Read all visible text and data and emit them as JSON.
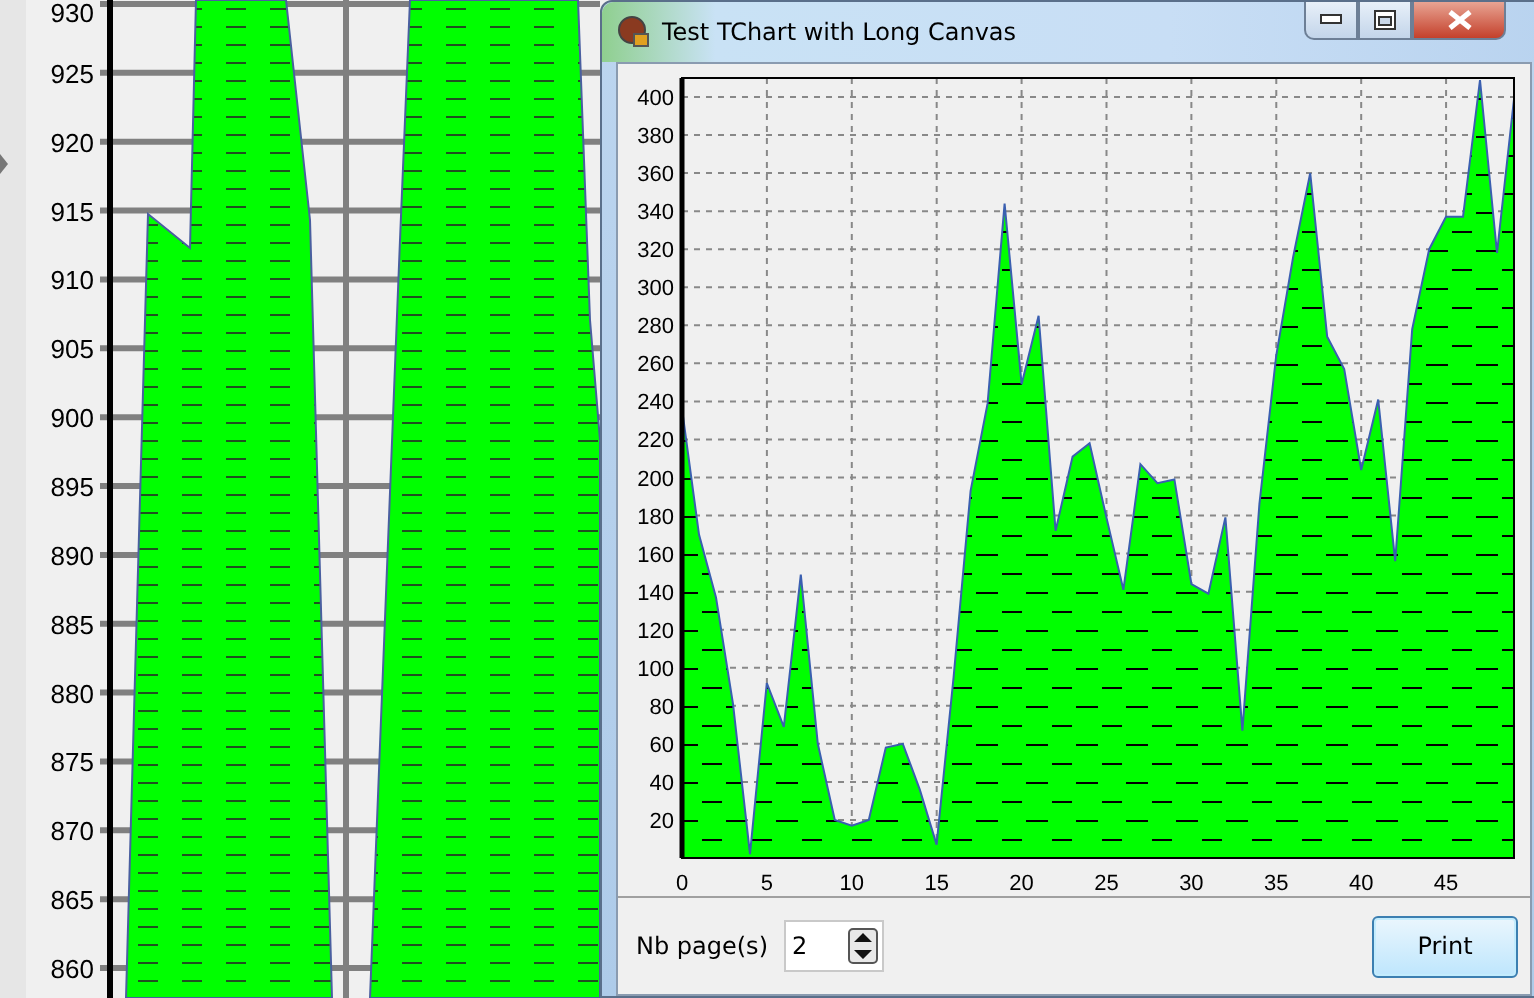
{
  "background_chart": {
    "y_axis_labels": [
      "930",
      "925",
      "920",
      "915",
      "910",
      "905",
      "900",
      "895",
      "890",
      "885",
      "880",
      "875",
      "870",
      "865",
      "860"
    ]
  },
  "window": {
    "title": "Test TChart with Long Canvas"
  },
  "chart": {
    "chart_data": {
      "type": "area",
      "grid": true,
      "xlim": [
        0,
        49
      ],
      "ylim": [
        0,
        410
      ],
      "xticks": [
        0,
        5,
        10,
        15,
        20,
        25,
        30,
        35,
        40,
        45
      ],
      "yticks": [
        20,
        40,
        60,
        80,
        100,
        120,
        140,
        160,
        180,
        200,
        220,
        240,
        260,
        280,
        300,
        320,
        340,
        360,
        380,
        400
      ],
      "x": [
        0,
        1,
        2,
        3,
        4,
        5,
        6,
        7,
        8,
        9,
        10,
        11,
        12,
        13,
        14,
        15,
        16,
        17,
        18,
        19,
        20,
        21,
        22,
        23,
        24,
        25,
        26,
        27,
        28,
        29,
        30,
        31,
        32,
        33,
        34,
        35,
        36,
        37,
        38,
        39,
        40,
        41,
        42,
        43,
        44,
        45,
        46,
        47,
        48,
        49
      ],
      "series": [
        {
          "color": "#00ff00",
          "values": [
            236,
            170,
            137,
            81,
            2,
            92,
            69,
            149,
            60,
            20,
            17,
            20,
            58,
            60,
            36,
            7,
            95,
            193,
            239,
            344,
            249,
            285,
            172,
            211,
            218,
            179,
            141,
            207,
            197,
            199,
            144,
            139,
            179,
            67,
            186,
            264,
            316,
            360,
            274,
            257,
            204,
            241,
            156,
            278,
            320,
            337,
            337,
            409,
            318,
            399
          ]
        }
      ]
    }
  },
  "pages_field": {
    "label": "Nb page(s)",
    "value": "2"
  },
  "buttons": [
    {
      "label": "Print"
    }
  ]
}
